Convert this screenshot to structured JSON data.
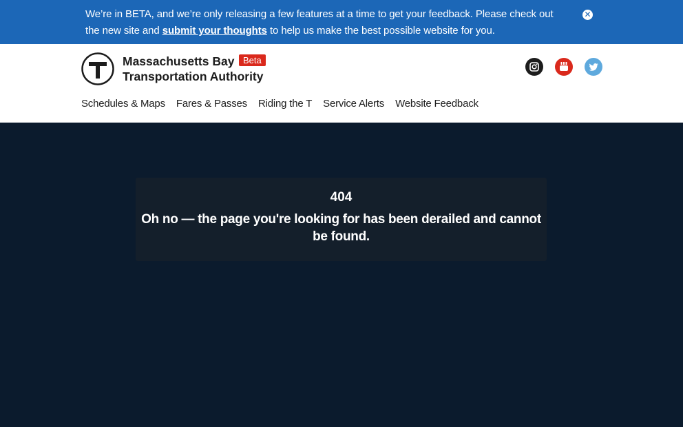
{
  "banner": {
    "text_before": "We’re in BETA, and we’re only releasing a few features at a time to get your feedback. Please check out the new site and ",
    "link_label": "submit your thoughts",
    "text_after": " to help us make the best possible website for you.",
    "close_glyph": "✕",
    "background_color": "#1c67b7"
  },
  "header": {
    "logo_letter": "T",
    "org_name_line1": "Massachusetts Bay",
    "org_name_line2": "Transportation Authority",
    "beta_badge": "Beta",
    "beta_color": "#da291c",
    "social": [
      {
        "name": "instagram-icon",
        "color": "#1c1c1c"
      },
      {
        "name": "youtube-icon",
        "color": "#da291c"
      },
      {
        "name": "twitter-icon",
        "color": "#5ea9dd"
      }
    ]
  },
  "nav": {
    "items": [
      {
        "label": "Schedules & Maps"
      },
      {
        "label": "Fares & Passes"
      },
      {
        "label": "Riding the T"
      },
      {
        "label": "Service Alerts"
      },
      {
        "label": "Website Feedback"
      }
    ]
  },
  "error": {
    "code": "404",
    "message": "Oh no — the page you're looking for has been derailed and cannot be found."
  },
  "colors": {
    "page_background": "#0b1b2d",
    "card_background": "#141f2b"
  }
}
